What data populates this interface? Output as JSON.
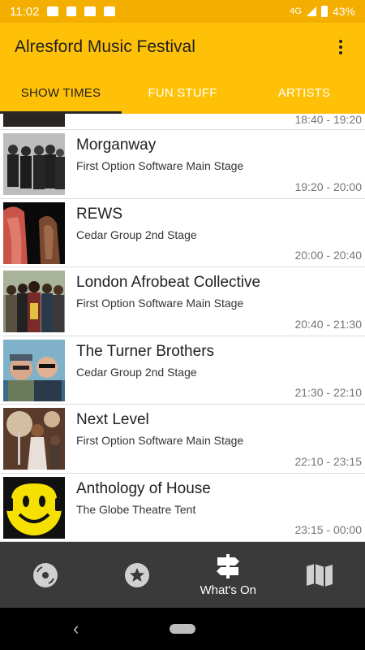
{
  "status_bar": {
    "time": "11:02",
    "network": "4G",
    "battery": "43%"
  },
  "app_bar": {
    "title": "Alresford Music Festival"
  },
  "tabs": [
    {
      "label": "SHOW TIMES",
      "active": true
    },
    {
      "label": "FUN STUFF",
      "active": false
    },
    {
      "label": "ARTISTS",
      "active": false
    }
  ],
  "partial_row": {
    "time": "18:40 - 19:20"
  },
  "events": [
    {
      "name": "Morganway",
      "stage": "First Option Software Main Stage",
      "time": "19:20 - 20:00"
    },
    {
      "name": "REWS",
      "stage": "Cedar Group 2nd Stage",
      "time": "20:00 - 20:40"
    },
    {
      "name": "London Afrobeat Collective",
      "stage": "First Option Software Main Stage",
      "time": "20:40 - 21:30"
    },
    {
      "name": "The Turner Brothers",
      "stage": "Cedar Group 2nd Stage",
      "time": "21:30 - 22:10"
    },
    {
      "name": "Next Level",
      "stage": "First Option Software Main Stage",
      "time": "22:10 - 23:15"
    },
    {
      "name": "Anthology of House",
      "stage": "The Globe Theatre Tent",
      "time": "23:15 - 00:00"
    }
  ],
  "bottom_nav": [
    {
      "icon": "record-icon",
      "label": ""
    },
    {
      "icon": "star-icon",
      "label": ""
    },
    {
      "icon": "signpost-icon",
      "label": "What's On",
      "active": true
    },
    {
      "icon": "map-icon",
      "label": ""
    }
  ],
  "colors": {
    "status_bar": "#f4ae00",
    "app_bar": "#ffc107",
    "bottom_nav": "#3a3a3a"
  }
}
